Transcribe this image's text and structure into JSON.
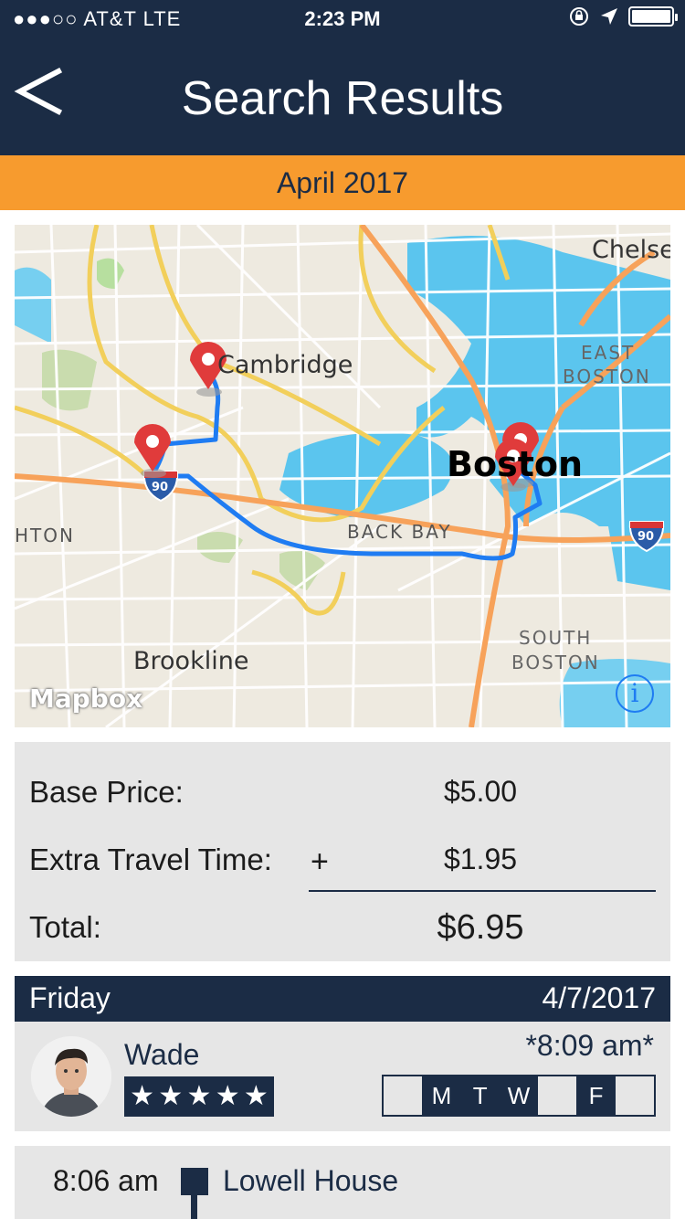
{
  "status_bar": {
    "carrier": "●●●○○ AT&T   LTE",
    "time": "2:23 PM"
  },
  "header": {
    "title": "Search Results"
  },
  "month": "April 2017",
  "map": {
    "labels": {
      "cambridge": "Cambridge",
      "boston": "Boston",
      "chelsea": "Chelse",
      "east_boston_1": "EAST",
      "east_boston_2": "BOSTON",
      "back_bay": "BACK BAY",
      "brighton": "HTON",
      "brookline": "Brookline",
      "south_boston_1": "SOUTH",
      "south_boston_2": "BOSTON",
      "shield_left": "90",
      "shield_right": "90"
    },
    "attribution": "Mapbox",
    "info": "i"
  },
  "pricing": {
    "base_label": "Base Price:",
    "base_value": "$5.00",
    "extra_label": "Extra Travel Time:",
    "extra_op": "+",
    "extra_value": "$1.95",
    "total_label": "Total:",
    "total_value": "$6.95"
  },
  "ride": {
    "day": "Friday",
    "date": "4/7/2017",
    "driver_name": "Wade",
    "rating_stars": 5,
    "time": "*8:09 am*",
    "days": [
      {
        "label": "",
        "active": false
      },
      {
        "label": "M",
        "active": true
      },
      {
        "label": "T",
        "active": true
      },
      {
        "label": "W",
        "active": true
      },
      {
        "label": "",
        "active": false
      },
      {
        "label": "F",
        "active": true
      },
      {
        "label": "",
        "active": false
      }
    ]
  },
  "stop": {
    "time": "8:06 am",
    "name": "Lowell House"
  },
  "colors": {
    "navy": "#1b2c45",
    "orange": "#f79b2e",
    "panel": "#e6e6e6",
    "route": "#1f7cf2",
    "pin": "#e03b3b",
    "water": "#5bc5ee"
  }
}
